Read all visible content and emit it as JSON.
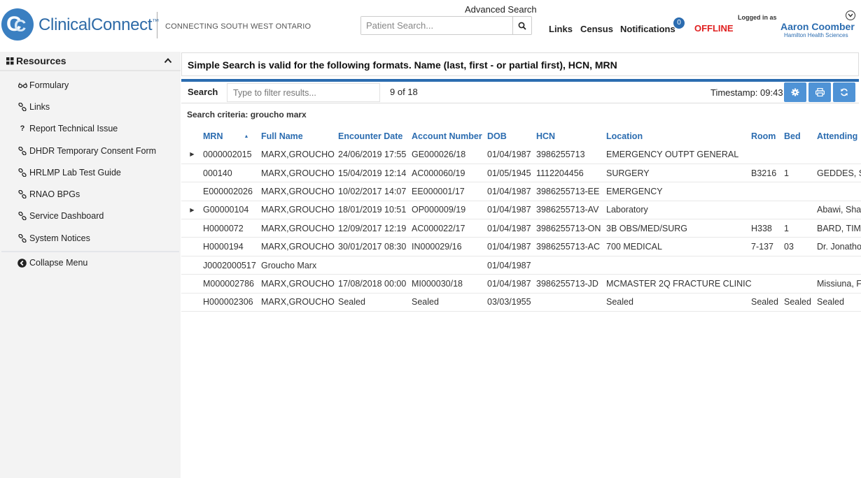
{
  "header": {
    "logo_letters": "CC",
    "brand_name": "ClinicalConnect",
    "brand_tm": "™",
    "tagline": "CONNECTING SOUTH WEST ONTARIO",
    "advanced_search": "Advanced Search",
    "patient_search_placeholder": "Patient Search...",
    "nav": {
      "links": "Links",
      "census": "Census",
      "notifications": "Notifications"
    },
    "notifications_count": "0",
    "status": "OFFLINE",
    "logged_in_label": "Logged in as",
    "user_name": "Aaron Coomber",
    "user_org": "Hamilton Health Sciences"
  },
  "sidebar": {
    "title": "Resources",
    "items": [
      {
        "label": "Formulary",
        "icon": "glasses-icon"
      },
      {
        "label": "Links",
        "icon": "link-icon"
      },
      {
        "label": "Report Technical Issue",
        "icon": "question-icon"
      },
      {
        "label": "DHDR Temporary Consent Form",
        "icon": "link-icon"
      },
      {
        "label": "HRLMP Lab Test Guide",
        "icon": "link-icon"
      },
      {
        "label": "RNAO BPGs",
        "icon": "link-icon"
      },
      {
        "label": "Service Dashboard",
        "icon": "link-icon"
      },
      {
        "label": "System Notices",
        "icon": "link-icon"
      }
    ],
    "collapse_label": "Collapse Menu"
  },
  "main": {
    "info": "Simple Search is valid for the following formats. Name (last, first - or partial first), HCN, MRN",
    "toolbar": {
      "search_label": "Search",
      "filter_placeholder": "Type to filter results...",
      "count": "9 of 18",
      "timestamp": "Timestamp: 09:43"
    },
    "criteria": "Search criteria: groucho marx",
    "columns": [
      "MRN",
      "Full Name",
      "Encounter Date",
      "Account Number",
      "DOB",
      "HCN",
      "Location",
      "Room",
      "Bed",
      "Attending"
    ],
    "rows": [
      {
        "expand": true,
        "cells": [
          "0000002015",
          "MARX,GROUCHO",
          "24/06/2019 17:55",
          "GE000026/18",
          "01/04/1987",
          "3986255713",
          "EMERGENCY OUTPT GENERAL",
          "",
          "",
          ""
        ]
      },
      {
        "expand": false,
        "cells": [
          "000140",
          "MARX,GROUCHO",
          "15/04/2019 12:14",
          "AC000060/19",
          "01/05/1945",
          "1112204456",
          "SURGERY",
          "B3216",
          "1",
          "GEDDES, S"
        ]
      },
      {
        "expand": false,
        "cells": [
          "E000002026",
          "MARX,GROUCHO",
          "10/02/2017 14:07",
          "EE000001/17",
          "01/04/1987",
          "3986255713-EE",
          "EMERGENCY",
          "",
          "",
          ""
        ]
      },
      {
        "expand": true,
        "cells": [
          "G00000104",
          "MARX,GROUCHO",
          "18/01/2019 10:51",
          "OP000009/19",
          "01/04/1987",
          "3986255713-AV",
          "Laboratory",
          "",
          "",
          "Abawi, Sha"
        ]
      },
      {
        "expand": false,
        "cells": [
          "H0000072",
          "MARX,GROUCHO",
          "12/09/2017 12:19",
          "AC000022/17",
          "01/04/1987",
          "3986255713-ON",
          "3B OBS/MED/SURG",
          "H338",
          "1",
          "BARD, TIM"
        ]
      },
      {
        "expand": false,
        "cells": [
          "H0000194",
          "MARX,GROUCHO",
          "30/01/2017 08:30",
          "IN000029/16",
          "01/04/1987",
          "3986255713-AC",
          "700 MEDICAL",
          "7-137",
          "03",
          "Dr. Jonatho"
        ]
      },
      {
        "expand": false,
        "cells": [
          "J0002000517",
          "Groucho Marx",
          "",
          "",
          "01/04/1987",
          "",
          "",
          "",
          "",
          ""
        ]
      },
      {
        "expand": false,
        "cells": [
          "M000002786",
          "MARX,GROUCHO",
          "17/08/2018 00:00",
          "MI000030/18",
          "01/04/1987",
          "3986255713-JD",
          "MCMASTER 2Q FRACTURE CLINIC",
          "",
          "",
          "Missiuna, F"
        ]
      },
      {
        "expand": false,
        "cells": [
          "H000002306",
          "MARX,GROUCHO",
          "Sealed",
          "Sealed",
          "03/03/1955",
          "",
          "Sealed",
          "Sealed",
          "Sealed",
          "Sealed"
        ]
      }
    ]
  },
  "colors": {
    "brand_blue": "#2d6aa7",
    "link_blue": "#2b6cb0",
    "button_blue": "#4f93d6",
    "offline_red": "#e02020",
    "sidebar_bg": "#f3f3f3"
  }
}
